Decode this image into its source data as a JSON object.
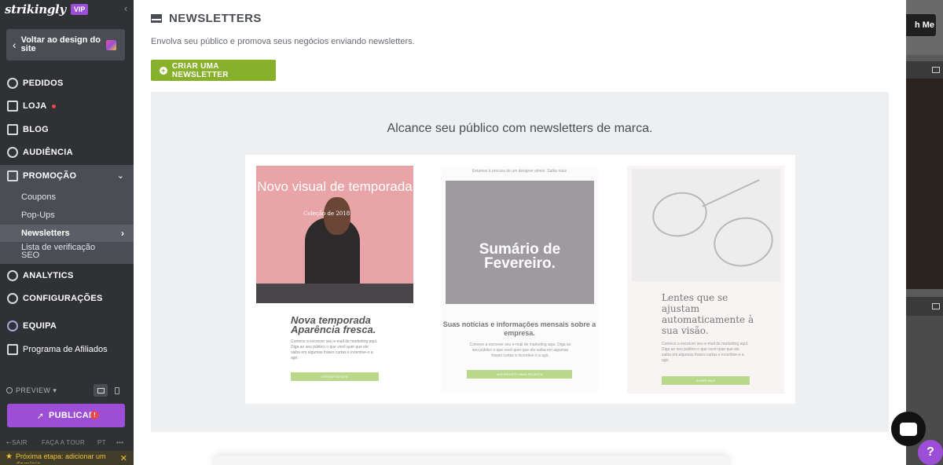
{
  "brand": {
    "logo": "strikingly",
    "badge": "VIP",
    "accent": "#9c4fd6",
    "green": "#87b02b"
  },
  "sidebar": {
    "back_label": "Voltar ao design do site",
    "nav": [
      {
        "label": "PEDIDOS",
        "icon": "dollar-icon"
      },
      {
        "label": "LOJA",
        "icon": "store-icon"
      },
      {
        "label": "BLOG",
        "icon": "pen-icon"
      },
      {
        "label": "AUDIÊNCIA",
        "icon": "people-icon"
      },
      {
        "label": "PROMOÇÃO",
        "icon": "megaphone-icon"
      }
    ],
    "sub": [
      "Coupons",
      "Pop-Ups",
      "Newsletters",
      "Lista de verificação SEO"
    ],
    "nav2": [
      {
        "label": "ANALYTICS",
        "icon": "analytics-icon"
      },
      {
        "label": "CONFIGURAÇÕES",
        "icon": "gear-icon"
      },
      {
        "label": "EQUIPA",
        "icon": "team-icon"
      },
      {
        "label": "Programa de Afiliados",
        "icon": "trophy-icon"
      }
    ],
    "preview": "PREVIEW",
    "publish": "PUBLICAR",
    "footer": {
      "exit": "SAIR",
      "tour": "FAÇA A TOUR",
      "lang": "PT",
      "more": "•••"
    },
    "next_step": "Próxima etapa: adicionar um domínio"
  },
  "main": {
    "title": "NEWSLETTERS",
    "subtitle": "Envolva seu público e promova seus negócios enviando newsletters.",
    "create_button": "CRIAR UMA NEWSLETTER",
    "headline": "Alcance seu público com newsletters de marca.",
    "cards": [
      {
        "hero_title": "Novo visual de temporada",
        "hero_small": "Coleção de 2018",
        "heading": "Nova temporada Aparência fresca.",
        "body": "Comece a escrever seu e-mail de marketing aqui. Diga ao seu público o que você quer que ele saiba em algumas frases curtas e incentive-o a agir.",
        "cta": "ENTRAR NO SITE"
      },
      {
        "pretitle": "Estamos à procura de um designer sênior. Saiba mais",
        "hero_title": "Sumário de Fevereiro.",
        "heading": "Suas notícias e informações mensais sobre a empresa.",
        "body": "Comece a escrever seu e-mail de marketing aqui. Diga ao seu público o que você quer que ele saiba em algumas frases curtas e incentive-o a agir.",
        "cta": "VER PROJETO MAIS RECENTE"
      },
      {
        "heading": "Lentes que se ajustam automaticamente à sua visão.",
        "body": "Comece a escrever seu e-mail de marketing aqui. Diga ao seu público o que você quer que ele saiba em algumas frases curtas e incentive-o a agir.",
        "cta": "SABER MAIS"
      }
    ]
  },
  "backdrop": {
    "button": "h Me"
  }
}
